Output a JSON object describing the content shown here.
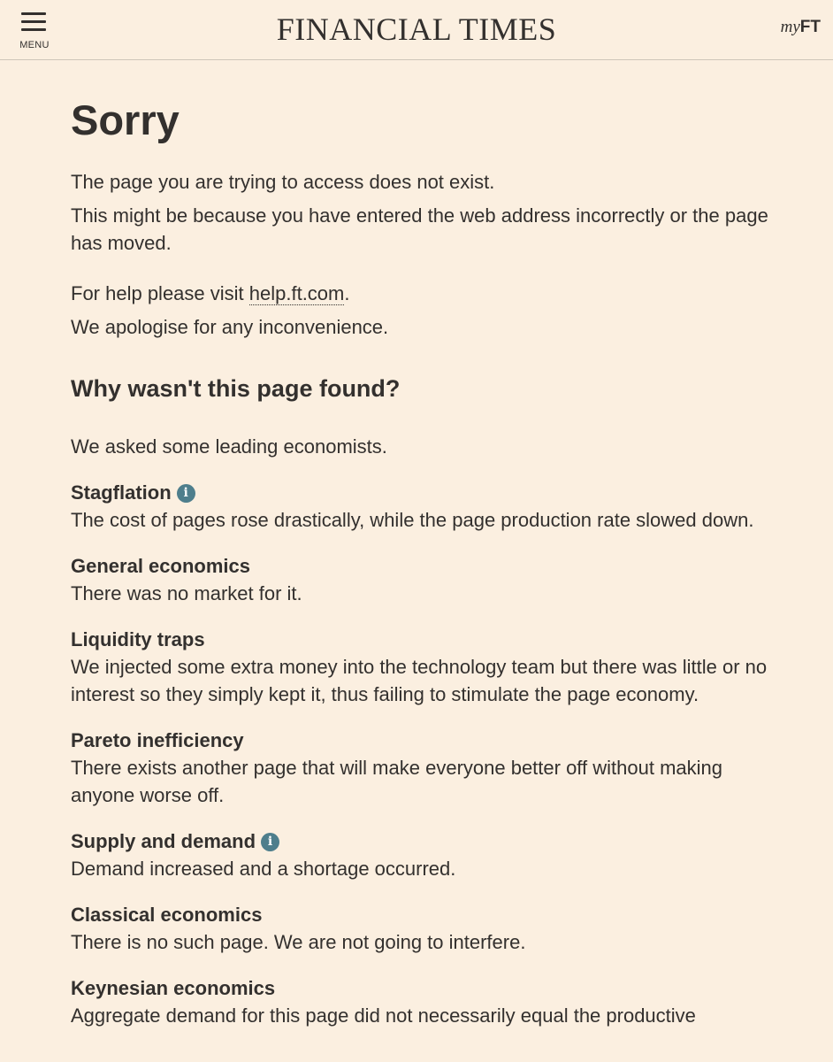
{
  "header": {
    "menu_label": "MENU",
    "logo": "FINANCIAL TIMES",
    "myft_my": "my",
    "myft_ft": "FT"
  },
  "main": {
    "title": "Sorry",
    "line1": "The page you are trying to access does not exist.",
    "line2": "This might be because you have entered the web address incorrectly or the page has moved.",
    "help_prefix": "For help please visit ",
    "help_link": "help.ft.com",
    "help_suffix": ".",
    "apology": "We apologise for any inconvenience.",
    "subheading": "Why wasn't this page found?",
    "intro": "We asked some leading economists.",
    "theories": [
      {
        "title": "Stagflation",
        "text": "The cost of pages rose drastically, while the page production rate slowed down.",
        "info": true
      },
      {
        "title": "General economics",
        "text": "There was no market for it.",
        "info": false
      },
      {
        "title": "Liquidity traps",
        "text": "We injected some extra money into the technology team but there was little or no interest so they simply kept it, thus failing to stimulate the page economy.",
        "info": false
      },
      {
        "title": "Pareto inefficiency",
        "text": "There exists another page that will make everyone better off without making anyone worse off.",
        "info": false
      },
      {
        "title": "Supply and demand",
        "text": "Demand increased and a shortage occurred.",
        "info": true
      },
      {
        "title": "Classical economics",
        "text": "There is no such page. We are not going to interfere.",
        "info": false
      },
      {
        "title": "Keynesian economics",
        "text": "Aggregate demand for this page did not necessarily equal the productive",
        "info": false
      }
    ],
    "info_glyph": "i"
  },
  "colors": {
    "background": "#fbefe0",
    "text": "#33302e",
    "info_icon": "#4e7e8c"
  }
}
